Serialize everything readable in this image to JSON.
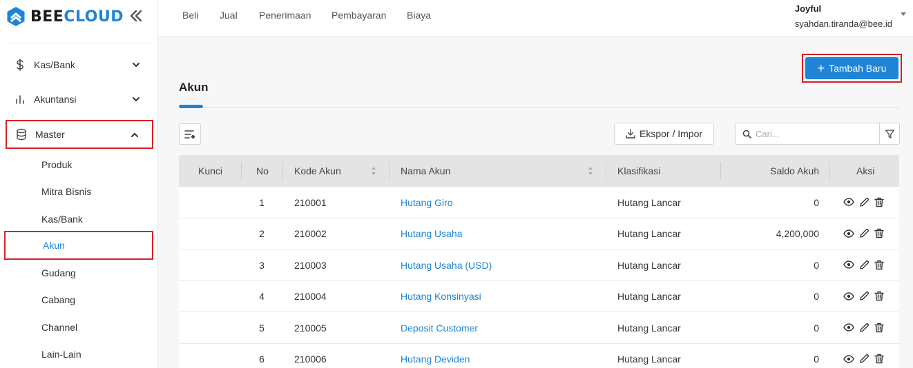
{
  "brand": {
    "bee": "BEE",
    "cloud": "CLOUD"
  },
  "sidebar": {
    "items": [
      {
        "label": "Kas/Bank",
        "icon": "dollar-icon"
      },
      {
        "label": "Akuntansi",
        "icon": "bar-chart-icon"
      },
      {
        "label": "Master",
        "icon": "database-icon"
      }
    ],
    "sub_items": [
      "Produk",
      "Mitra Bisnis",
      "Kas/Bank",
      "Akun",
      "Gudang",
      "Cabang",
      "Channel",
      "Lain-Lain"
    ],
    "active_sub": "Akun"
  },
  "topnav": {
    "links": [
      "Beli",
      "Jual",
      "Penerimaan",
      "Pembayaran",
      "Biaya"
    ],
    "user_name": "Joyful",
    "user_email": "syahdan.tiranda@bee.id"
  },
  "main": {
    "add_button": "Tambah Baru",
    "title": "Akun",
    "export_button": "Ekspor / Impor",
    "search_placeholder": "Cari..."
  },
  "table": {
    "headers": [
      "Kunci",
      "No",
      "Kode Akun",
      "Nama Akun",
      "Klasifikasi",
      "Saldo Akun",
      "Aksi"
    ],
    "rows": [
      {
        "no": "1",
        "kode": "210001",
        "nama": "Hutang Giro",
        "klasifikasi": "Hutang Lancar",
        "saldo": "0"
      },
      {
        "no": "2",
        "kode": "210002",
        "nama": "Hutang Usaha",
        "klasifikasi": "Hutang Lancar",
        "saldo": "4,200,000"
      },
      {
        "no": "3",
        "kode": "210003",
        "nama": "Hutang Usaha (USD)",
        "klasifikasi": "Hutang Lancar",
        "saldo": "0"
      },
      {
        "no": "4",
        "kode": "210004",
        "nama": "Hutang Konsinyasi",
        "klasifikasi": "Hutang Lancar",
        "saldo": "0"
      },
      {
        "no": "5",
        "kode": "210005",
        "nama": "Deposit Customer",
        "klasifikasi": "Hutang Lancar",
        "saldo": "0"
      },
      {
        "no": "6",
        "kode": "210006",
        "nama": "Hutang Deviden",
        "klasifikasi": "Hutang Lancar",
        "saldo": "0"
      }
    ]
  },
  "colors": {
    "accent": "#1f84d6",
    "highlight": "#d91f26"
  }
}
